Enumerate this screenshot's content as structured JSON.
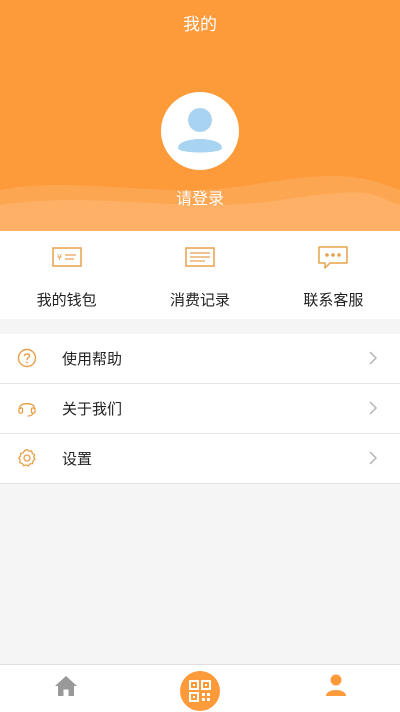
{
  "header": {
    "title": "我的",
    "login_text": "请登录",
    "accent_color": "#fd9a3a"
  },
  "quick_actions": [
    {
      "label": "我的钱包",
      "icon": "wallet-icon"
    },
    {
      "label": "消费记录",
      "icon": "receipt-icon"
    },
    {
      "label": "联系客服",
      "icon": "chat-bubble-icon"
    }
  ],
  "menu": [
    {
      "label": "使用帮助",
      "icon": "question-circle-icon"
    },
    {
      "label": "关于我们",
      "icon": "headset-icon"
    },
    {
      "label": "设置",
      "icon": "gear-icon"
    }
  ],
  "tabbar": {
    "items": [
      {
        "icon": "home-icon"
      },
      {
        "icon": "qr-scan-icon"
      },
      {
        "icon": "person-icon"
      }
    ]
  }
}
